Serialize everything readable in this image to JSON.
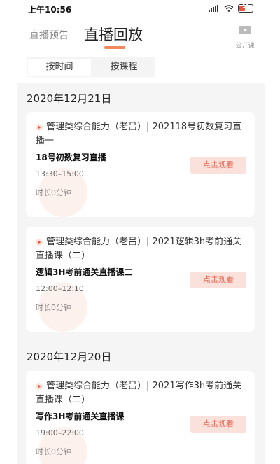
{
  "status": {
    "time": "上午10:56",
    "battery": "18"
  },
  "header": {
    "tab_preview": "直播预告",
    "tab_replay": "直播回放",
    "open_class": "公开课"
  },
  "filters": [
    "按时间",
    "按课程"
  ],
  "groups": [
    {
      "date": "2020年12月21日",
      "cards": [
        {
          "title": "管理类综合能力（老吕）| 202118号初数复习直播一",
          "subtitle": "18号初数复习直播",
          "time": "13:30–15:00",
          "duration": "时长0分钟",
          "button": "点击观看"
        },
        {
          "title": "管理类综合能力（老吕）| 2021逻辑3h考前通关直播课（二）",
          "subtitle": "逻辑3H考前通关直播课二",
          "time": "12:00–12:10",
          "duration": "时长0分钟",
          "button": "点击观看"
        }
      ]
    },
    {
      "date": "2020年12月20日",
      "cards": [
        {
          "title": "管理类综合能力（老吕）| 2021写作3h考前通关直播课（二）",
          "subtitle": "写作3H考前通关直播课",
          "time": "19:00–22:00",
          "duration": "时长0分钟",
          "button": "点击观看"
        }
      ]
    }
  ],
  "colors": {
    "accent": "#f08a5d",
    "button_bg": "#fbe1dc",
    "button_text": "#e46a55",
    "play_icon": "#e8543a"
  }
}
